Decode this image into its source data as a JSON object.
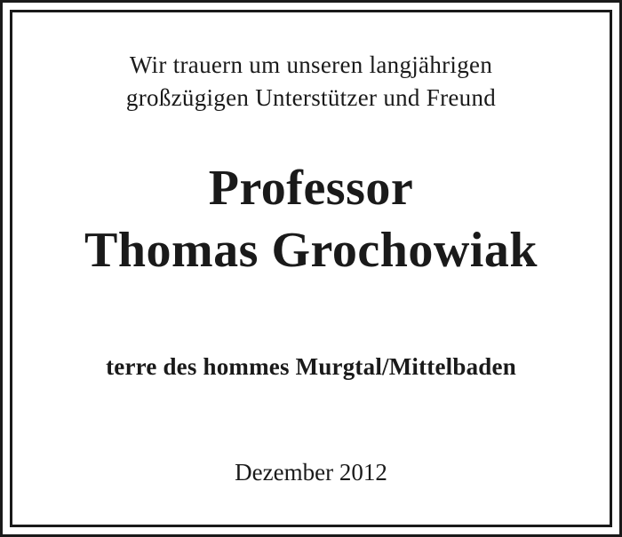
{
  "notice": {
    "intro_line_1": "Wir trauern um unseren langjährigen",
    "intro_line_2": "großzügigen Unterstützer und Freund",
    "name_line_1": "Professor",
    "name_line_2": "Thomas Grochowiak",
    "organization": "terre des hommes Murgtal/Mittelbaden",
    "date": "Dezember 2012"
  },
  "colors": {
    "text": "#1a1a1a",
    "border": "#1a1a1a",
    "background": "#ffffff"
  }
}
